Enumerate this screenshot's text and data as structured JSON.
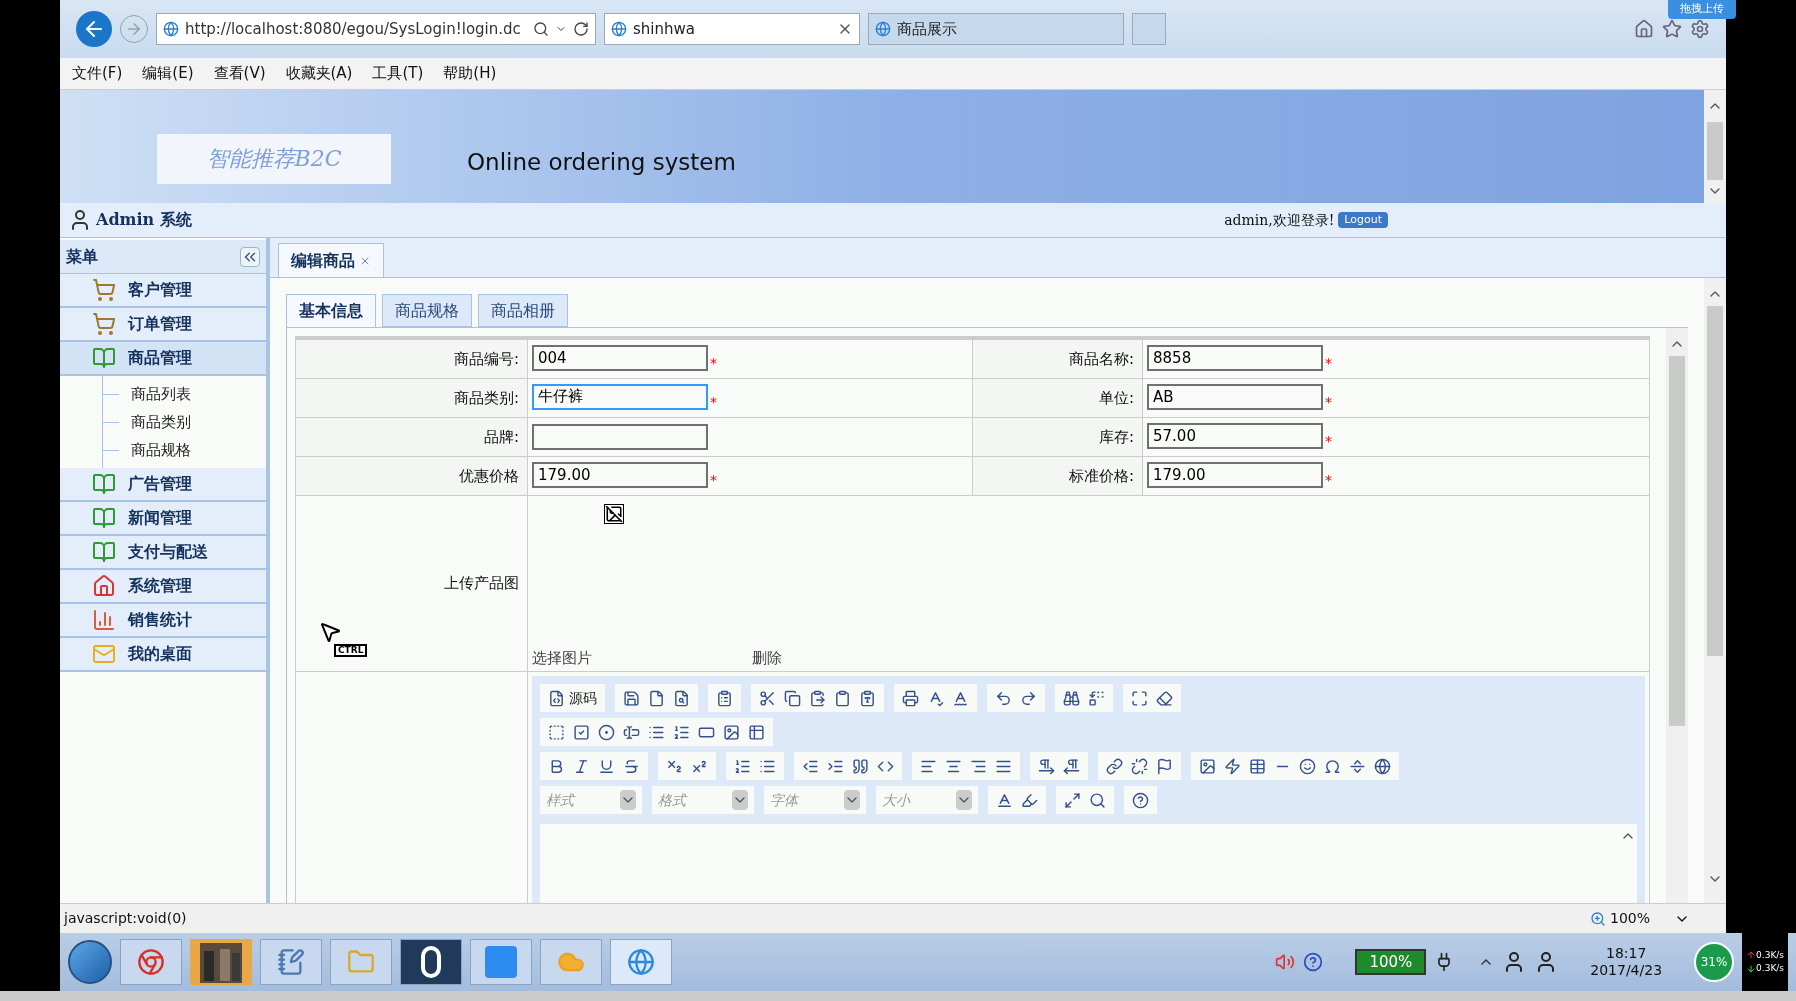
{
  "browser": {
    "address": "http://localhost:8080/egou/SysLogin!login.dc",
    "tabs": [
      {
        "title": "shinhwa",
        "selected": true
      },
      {
        "title": "商品展示",
        "selected": false
      }
    ],
    "menu": [
      "文件(F)",
      "编辑(E)",
      "查看(V)",
      "收藏夹(A)",
      "工具(T)",
      "帮助(H)"
    ],
    "upload_badge": "拖拽上传"
  },
  "header": {
    "logo": "智能推荐B2C",
    "subtitle": "Online ordering system"
  },
  "user_bar": {
    "title": "Admin 系统",
    "welcome": "admin,欢迎登录!",
    "logout": "Logout"
  },
  "sidebar": {
    "title": "菜单",
    "items": [
      {
        "label": "客户管理",
        "kind": "cart",
        "expanded": false
      },
      {
        "label": "订单管理",
        "kind": "cart",
        "expanded": false
      },
      {
        "label": "商品管理",
        "kind": "book",
        "expanded": true,
        "children": [
          {
            "label": "商品列表"
          },
          {
            "label": "商品类别"
          },
          {
            "label": "商品规格"
          }
        ]
      },
      {
        "label": "广告管理",
        "kind": "book",
        "expanded": false
      },
      {
        "label": "新闻管理",
        "kind": "book",
        "expanded": false
      },
      {
        "label": "支付与配送",
        "kind": "book",
        "expanded": false
      },
      {
        "label": "系统管理",
        "kind": "house",
        "expanded": false
      },
      {
        "label": "销售统计",
        "kind": "chart",
        "expanded": false
      },
      {
        "label": "我的桌面",
        "kind": "mail",
        "expanded": false
      }
    ]
  },
  "page_tab": {
    "label": "编辑商品"
  },
  "sub_tabs": [
    {
      "label": "基本信息",
      "selected": true
    },
    {
      "label": "商品规格",
      "selected": false
    },
    {
      "label": "商品相册",
      "selected": false
    }
  ],
  "form": {
    "rows": [
      {
        "left": {
          "label": "商品编号:",
          "value": "004",
          "required_mark": "*",
          "focused": false
        },
        "right": {
          "label": "商品名称:",
          "value": "8858",
          "required_mark": "*",
          "focused": false
        }
      },
      {
        "left": {
          "label": "商品类别:",
          "value": "牛仔裤",
          "required_mark": "*",
          "focused": true
        },
        "right": {
          "label": "单位:",
          "value": "AB",
          "required_mark": "*",
          "focused": false
        }
      },
      {
        "left": {
          "label": "品牌:",
          "focused": false
        },
        "right": {
          "label": "库存:",
          "value": "57.00",
          "required_mark": "*",
          "focused": false
        }
      },
      {
        "left": {
          "label": "优惠价格",
          "value": "179.00",
          "required_mark": "*",
          "focused": false
        },
        "right": {
          "label": "标准价格:",
          "value": "179.00",
          "required_mark": "*",
          "focused": false
        }
      }
    ],
    "upload": {
      "label": "上传产品图",
      "choose": "选择图片",
      "delete": "删除"
    }
  },
  "editor": {
    "source_label": "源码",
    "combos": [
      {
        "placeholder": "样式"
      },
      {
        "placeholder": "格式"
      },
      {
        "placeholder": "字体"
      },
      {
        "placeholder": "大小"
      }
    ]
  },
  "cursor_hint": "CTRL",
  "status_bar": {
    "text": "javascript:void(0)",
    "zoom": "100%"
  },
  "taskbar": {
    "battery": "100%",
    "time": "18:17",
    "date": "2017/4/23",
    "network": "31%",
    "upload_speed": "0.3K/s",
    "download_speed": "0.3K/s"
  }
}
